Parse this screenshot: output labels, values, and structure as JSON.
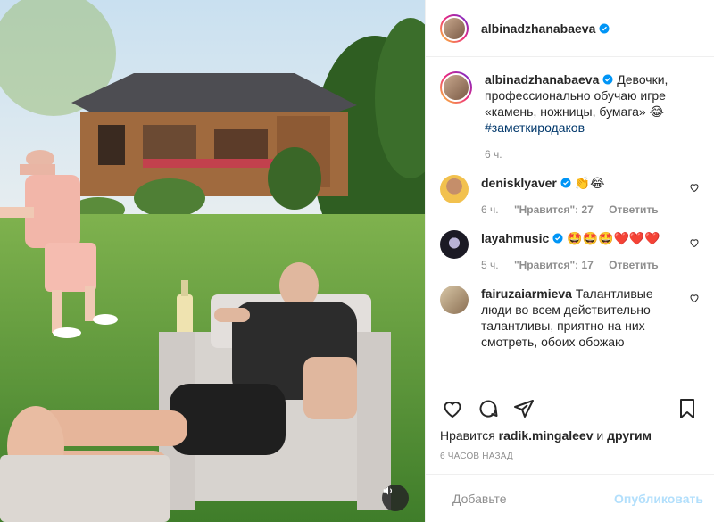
{
  "header": {
    "username": "albinadzhanabaeva"
  },
  "caption": {
    "username": "albinadzhanabaeva",
    "text": "Девочки, профессионально обучаю игре «камень, ножницы, бумага» 😂",
    "hashtag": "#заметкиродаков",
    "time": "6 ч."
  },
  "comments": [
    {
      "username": "denisklyaver",
      "text": "👏😂",
      "time": "6 ч.",
      "likes": "\"Нравится\": 27",
      "reply": "Ответить",
      "verified": true
    },
    {
      "username": "layahmusic",
      "text": "🤩🤩🤩❤️❤️❤️",
      "time": "5 ч.",
      "likes": "\"Нравится\": 17",
      "reply": "Ответить",
      "verified": true
    },
    {
      "username": "fairuzaiarmieva",
      "text": "Талантливые люди во всем действительно талантливы, приятно на них смотреть, обоих обожаю",
      "verified": false
    }
  ],
  "likes_line": {
    "prefix": "Нравится",
    "user": "radik.mingaleev",
    "middle": "и",
    "suffix": "другим"
  },
  "post_time": "6 часов назад",
  "add_comment": {
    "placeholder": "Добавьте",
    "publish": "Опубликовать"
  },
  "colors": {
    "verified": "#0095f6",
    "link": "#00376b",
    "muted": "#8e8e8e",
    "publish_disabled": "#b2dffc"
  }
}
